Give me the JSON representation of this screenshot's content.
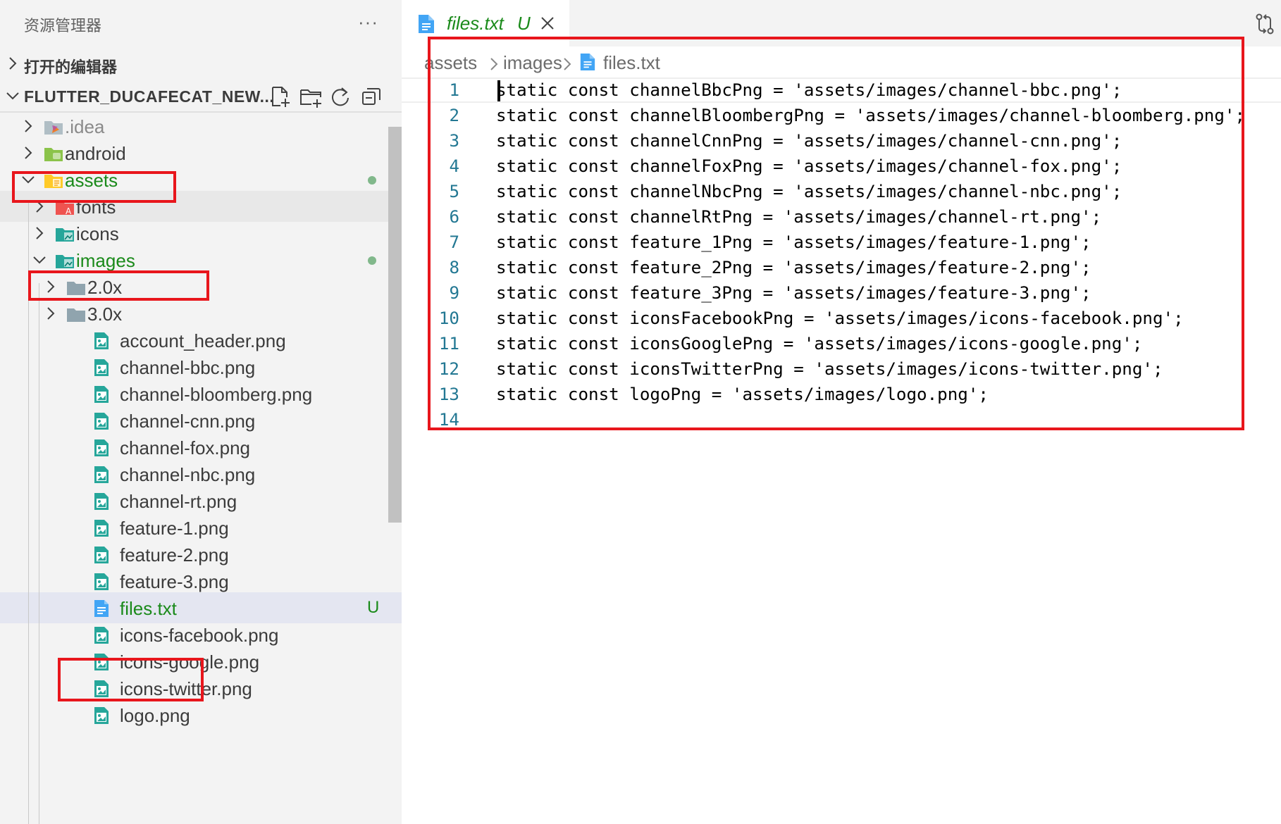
{
  "explorer": {
    "title": "资源管理器",
    "more": "···",
    "open_editors_label": "打开的编辑器",
    "project_label": "FLUTTER_DUCAFECAT_NEW...",
    "toolbar": [
      "new-file",
      "new-folder",
      "refresh",
      "collapse-all"
    ]
  },
  "tree": [
    {
      "name": ".idea",
      "type": "folder",
      "icon": "idea-folder-icon",
      "expanded": false
    },
    {
      "name": "android",
      "type": "folder",
      "icon": "android-folder-icon",
      "expanded": false
    },
    {
      "name": "assets",
      "type": "folder",
      "icon": "assets-folder-icon",
      "expanded": true,
      "modified_dot": true
    },
    {
      "name": "fonts",
      "type": "folder",
      "icon": "fonts-folder-icon",
      "expanded": false
    },
    {
      "name": "icons",
      "type": "folder",
      "icon": "images-folder-icon",
      "expanded": false
    },
    {
      "name": "images",
      "type": "folder",
      "icon": "images-folder-icon",
      "expanded": true,
      "modified_dot": true
    },
    {
      "name": "2.0x",
      "type": "folder",
      "icon": "folder-icon",
      "expanded": false
    },
    {
      "name": "3.0x",
      "type": "folder",
      "icon": "folder-icon",
      "expanded": false
    },
    {
      "name": "account_header.png",
      "type": "image"
    },
    {
      "name": "channel-bbc.png",
      "type": "image"
    },
    {
      "name": "channel-bloomberg.png",
      "type": "image"
    },
    {
      "name": "channel-cnn.png",
      "type": "image"
    },
    {
      "name": "channel-fox.png",
      "type": "image"
    },
    {
      "name": "channel-nbc.png",
      "type": "image"
    },
    {
      "name": "channel-rt.png",
      "type": "image"
    },
    {
      "name": "feature-1.png",
      "type": "image"
    },
    {
      "name": "feature-2.png",
      "type": "image"
    },
    {
      "name": "feature-3.png",
      "type": "image"
    },
    {
      "name": "files.txt",
      "type": "text",
      "badge": "U",
      "selected": true
    },
    {
      "name": "icons-facebook.png",
      "type": "image"
    },
    {
      "name": "icons-google.png",
      "type": "image"
    },
    {
      "name": "icons-twitter.png",
      "type": "image"
    },
    {
      "name": "logo.png",
      "type": "image"
    }
  ],
  "editor": {
    "tab": {
      "name": "files.txt",
      "badge": "U",
      "close": "close-icon"
    },
    "breadcrumb": [
      "assets",
      "images",
      "files.txt"
    ],
    "lines": [
      {
        "n": "1",
        "text": "static const channelBbcPng = 'assets/images/channel-bbc.png';"
      },
      {
        "n": "2",
        "text": "static const channelBloombergPng = 'assets/images/channel-bloomberg.png';"
      },
      {
        "n": "3",
        "text": "static const channelCnnPng = 'assets/images/channel-cnn.png';"
      },
      {
        "n": "4",
        "text": "static const channelFoxPng = 'assets/images/channel-fox.png';"
      },
      {
        "n": "5",
        "text": "static const channelNbcPng = 'assets/images/channel-nbc.png';"
      },
      {
        "n": "6",
        "text": "static const channelRtPng = 'assets/images/channel-rt.png';"
      },
      {
        "n": "7",
        "text": "static const feature_1Png = 'assets/images/feature-1.png';"
      },
      {
        "n": "8",
        "text": "static const feature_2Png = 'assets/images/feature-2.png';"
      },
      {
        "n": "9",
        "text": "static const feature_3Png = 'assets/images/feature-3.png';"
      },
      {
        "n": "10",
        "text": "static const iconsFacebookPng = 'assets/images/icons-facebook.png';"
      },
      {
        "n": "11",
        "text": "static const iconsGooglePng = 'assets/images/icons-google.png';"
      },
      {
        "n": "12",
        "text": "static const iconsTwitterPng = 'assets/images/icons-twitter.png';"
      },
      {
        "n": "13",
        "text": "static const logoPng = 'assets/images/logo.png';"
      },
      {
        "n": "14",
        "text": ""
      }
    ]
  },
  "colors": {
    "git_untracked": "#1a8a1a",
    "modified_dot": "#81b88b",
    "annotation": "#e8161c",
    "line_number": "#237893"
  }
}
